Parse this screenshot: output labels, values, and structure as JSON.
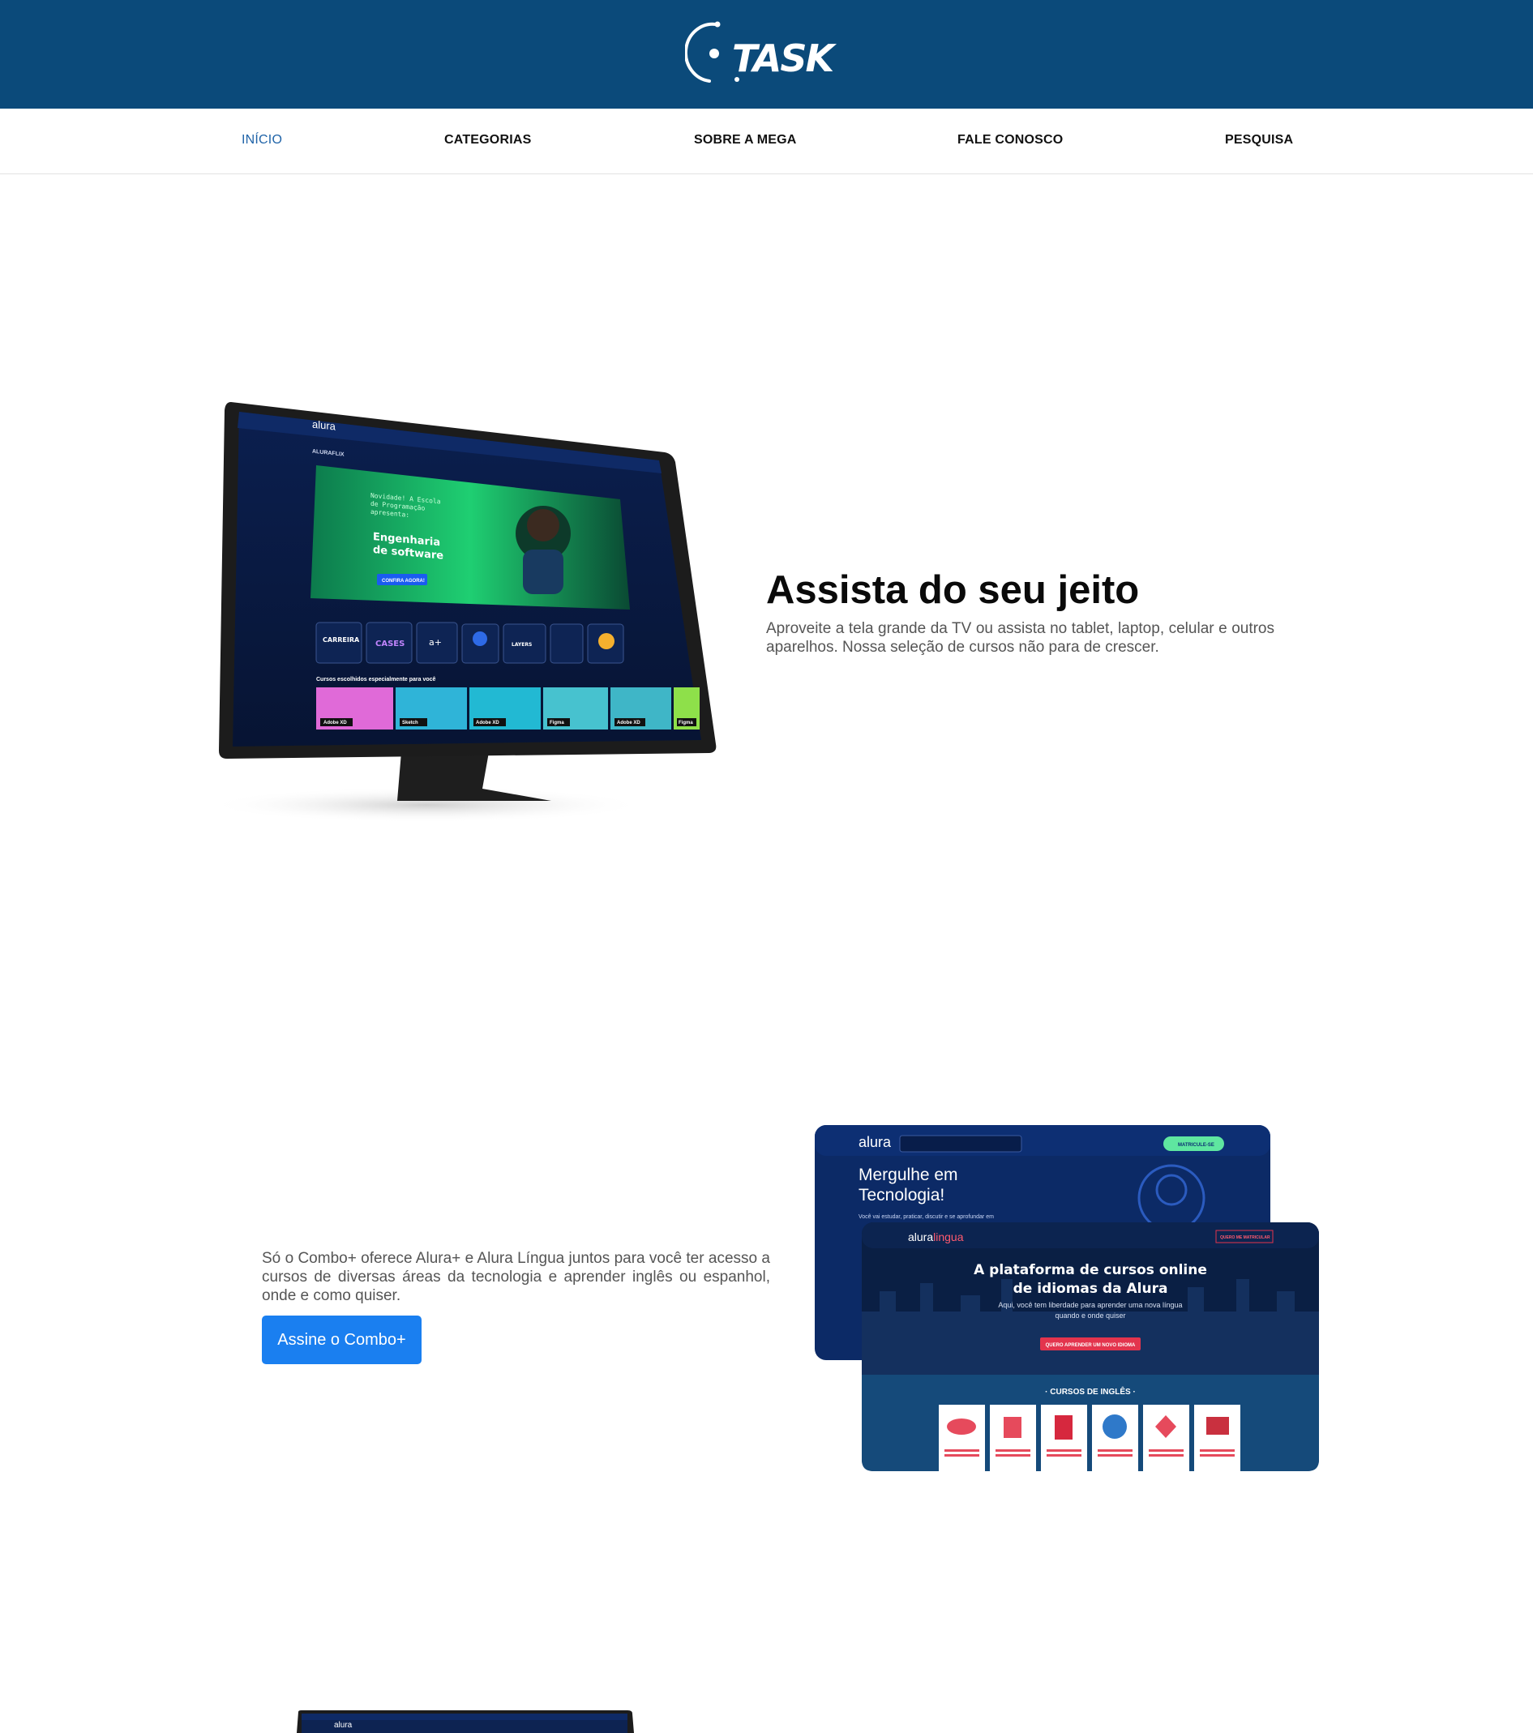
{
  "header": {
    "logo_text": "TASK",
    "bg_color": "#0b4a7a"
  },
  "nav": {
    "items": [
      {
        "label": "INÍCIO",
        "active": true
      },
      {
        "label": "CATEGORIAS",
        "active": false
      },
      {
        "label": "SOBRE A MEGA",
        "active": false
      },
      {
        "label": "FALE CONOSCO",
        "active": false
      },
      {
        "label": "PESQUISA",
        "active": false
      }
    ],
    "active_color": "#1f63a8"
  },
  "section1": {
    "title": "Assista do seu jeito",
    "text": "Aproveite a tela grande da TV ou assista no tablet, laptop, celular e outros aparelhos. Nossa seleção de cursos não para de crescer.",
    "image": {
      "brand": "alura",
      "menu": "ALURAFLIX",
      "banner_line1": "Novidade! A Escola de Programação apresenta:",
      "banner_line2": "Engenharia de software",
      "banner_cta": "CONFIRA AGORA!",
      "row_title": "Cursos escolhidos especialmente para você",
      "tiles": [
        "CARREIRA",
        "CASES",
        "a+",
        "",
        "LAYERS",
        "",
        ""
      ],
      "course_cards": [
        "Adobe XD",
        "Sketch",
        "Adobe XD",
        "Figma",
        "Adobe XD",
        "Figma"
      ]
    }
  },
  "section2": {
    "text": "Só o Combo+ oferece Alura+ e Alura Língua juntos para você ter acesso a cursos de diversas áreas da tecnologia e aprender inglês ou espanhol, onde e como quiser.",
    "button_label": "Assine o Combo+",
    "button_color": "#1a7ff0",
    "image": {
      "back_brand": "alura",
      "back_headline": "Mergulhe em Tecnologia!",
      "back_sub": "Você vai estudar, praticar, discutir e se aprofundar em",
      "back_cta": "MATRICULE-SE",
      "front_brand": "aluralingua",
      "front_headline": "A plataforma de cursos online de idiomas da Alura",
      "front_sub": "Aqui, você tem liberdade para aprender uma nova língua quando e onde quiser",
      "front_cta": "QUERO APRENDER UM NOVO IDIOMA",
      "front_signup": "QUERO ME MATRICULAR",
      "courses_title": "· CURSOS DE INGLÊS ·",
      "course_count": 6
    }
  }
}
